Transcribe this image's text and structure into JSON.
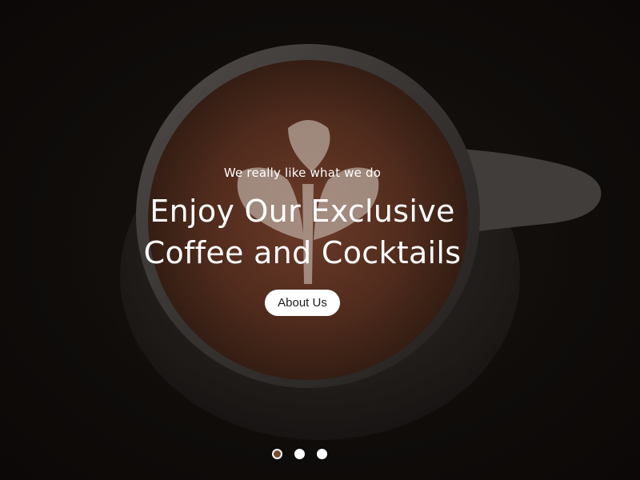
{
  "hero": {
    "subtitle": "We really like what we do",
    "title_line1": "Enjoy Our Exclusive",
    "title_line2": "Coffee and Cocktails",
    "cta_label": "About Us",
    "background_image": "coffee-cup-latte-art"
  },
  "slider": {
    "dots": [
      {
        "label": "slide 1",
        "active": true
      },
      {
        "label": "slide 2",
        "active": false
      },
      {
        "label": "slide 3",
        "active": false
      }
    ],
    "active_color": "#7a4b34",
    "inactive_color": "#ffffff"
  }
}
